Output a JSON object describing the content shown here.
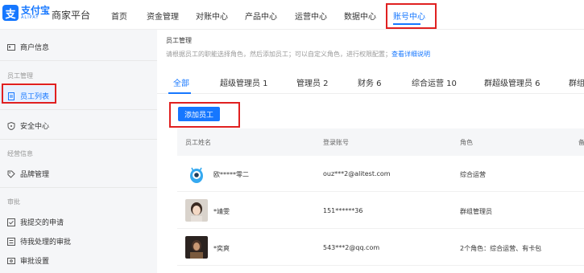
{
  "brand": {
    "logo_cn": "支付宝",
    "logo_en": "ALIPAY",
    "platform": "商家平台",
    "accent": "#1677ff"
  },
  "topnav": [
    "首页",
    "资金管理",
    "对账中心",
    "产品中心",
    "运营中心",
    "数据中心",
    "账号中心"
  ],
  "topnav_active": "账号中心",
  "sidebar": {
    "merchant_info": "商户信息",
    "group_staff": "员工管理",
    "staff_list": "员工列表",
    "security": "安全中心",
    "group_operation": "经营信息",
    "brand_manage": "品牌管理",
    "group_approval": "审批",
    "my_submitted": "我提交的申请",
    "pending": "待我处理的审批",
    "approval_settings": "审批设置"
  },
  "page": {
    "title": "员工管理",
    "desc": "请根据员工的职能选择角色，然后添加员工；可以自定义角色，进行权限配置；",
    "desc_link": "查看详细说明"
  },
  "tabs": [
    "全部",
    "超级管理员 1",
    "管理员 2",
    "财务 6",
    "综合运营 10",
    "群超级管理员 6",
    "群组"
  ],
  "add_button": "添加员工",
  "table": {
    "columns": [
      "员工姓名",
      "登录账号",
      "角色",
      "备"
    ],
    "rows": [
      {
        "name": "欧*****零二",
        "account": "ouz***2@alitest.com",
        "role": "综合运营"
      },
      {
        "name": "*靖雯",
        "account": "151******36",
        "role": "群组管理员"
      },
      {
        "name": "*奕爽",
        "account": "543***2@qq.com",
        "role": "2个角色：综合运营、有卡包"
      }
    ]
  },
  "highlight_color": "#e02020"
}
